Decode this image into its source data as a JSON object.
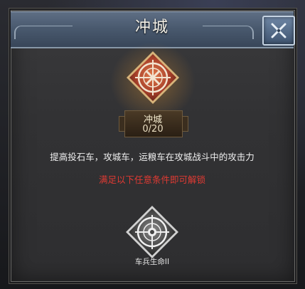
{
  "dialog": {
    "title": "冲城",
    "close_icon": "close-x-icon"
  },
  "skill": {
    "icon": "siege-compass-icon",
    "name": "冲城",
    "level": "0/20",
    "description": "提高投石车，攻城车，运粮车在攻城战斗中的攻击力"
  },
  "unlock": {
    "condition_text": "满足以下任意条件即可解锁",
    "requirements": [
      {
        "icon": "chariot-compass-icon",
        "label": "车兵生命II"
      }
    ]
  },
  "colors": {
    "title_bar": "#4a5a6f",
    "unlock_text": "#e03a33",
    "skill_accent": "#c8643a"
  }
}
